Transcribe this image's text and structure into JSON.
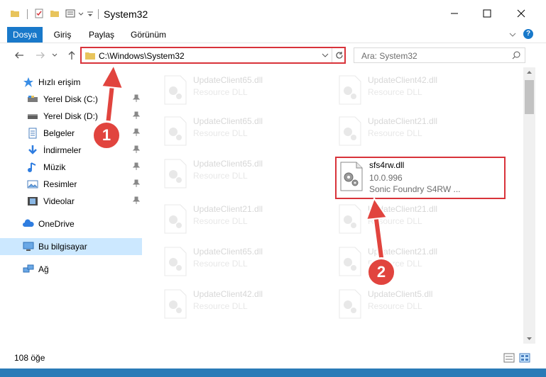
{
  "window": {
    "title": "System32"
  },
  "ribbon": {
    "tabs": [
      {
        "label": "Dosya",
        "active": true
      },
      {
        "label": "Giriş",
        "active": false
      },
      {
        "label": "Paylaş",
        "active": false
      },
      {
        "label": "Görünüm",
        "active": false
      }
    ]
  },
  "address": {
    "path": "C:\\Windows\\System32"
  },
  "search": {
    "placeholder": "Ara: System32"
  },
  "sidebar": {
    "items": [
      {
        "label": "Hızlı erişim",
        "icon": "star-icon"
      },
      {
        "label": "Yerel Disk (C:)",
        "icon": "disk-icon",
        "pinned": true
      },
      {
        "label": "Yerel Disk (D:)",
        "icon": "disk-icon",
        "pinned": true
      },
      {
        "label": "Belgeler",
        "icon": "documents-icon",
        "pinned": true
      },
      {
        "label": "İndirmeler",
        "icon": "download-icon",
        "pinned": true
      },
      {
        "label": "Müzik",
        "icon": "music-icon",
        "pinned": true
      },
      {
        "label": "Resimler",
        "icon": "pictures-icon",
        "pinned": true
      },
      {
        "label": "Videolar",
        "icon": "video-icon",
        "pinned": true
      },
      {
        "label": "OneDrive",
        "icon": "cloud-icon"
      },
      {
        "label": "Bu bilgisayar",
        "icon": "computer-icon",
        "selected": true
      },
      {
        "label": "Ağ",
        "icon": "network-icon"
      }
    ]
  },
  "files": [
    {
      "name": "UpdateClient65.dll",
      "sub": "Resource DLL",
      "faded": true
    },
    {
      "name": "UpdateClient42.dll",
      "sub": "Resource DLL",
      "faded": true
    },
    {
      "name": "UpdateClient65.dll",
      "sub": "Resource DLL",
      "faded": true
    },
    {
      "name": "UpdateClient21.dll",
      "sub": "Resource DLL",
      "faded": true
    },
    {
      "name": "UpdateClient65.dll",
      "sub": "Resource DLL",
      "faded": true
    },
    {
      "name": "sfs4rw.dll",
      "version": "10.0.996",
      "sub": "Sonic Foundry S4RW ...",
      "faded": false
    },
    {
      "name": "UpdateClient21.dll",
      "sub": "Resource DLL",
      "faded": true
    },
    {
      "name": "UpdateClient21.dll",
      "sub": "Resource DLL",
      "faded": true
    },
    {
      "name": "UpdateClient65.dll",
      "sub": "Resource DLL",
      "faded": true
    },
    {
      "name": "UpdateClient21.dll",
      "sub": "Resource DLL",
      "faded": true
    },
    {
      "name": "UpdateClient42.dll",
      "sub": "Resource DLL",
      "faded": true
    },
    {
      "name": "UpdateClient5.dll",
      "sub": "Resource DLL",
      "faded": true
    }
  ],
  "status": {
    "count": "108 öğe"
  },
  "annotations": {
    "step1": "1",
    "step2": "2"
  },
  "colors": {
    "accent": "#1979ca",
    "highlight": "#d8333a",
    "selection": "#cce8ff"
  }
}
